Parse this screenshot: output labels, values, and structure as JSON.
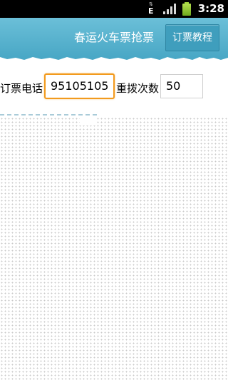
{
  "status_bar": {
    "network_type": "E",
    "network_arrows": "⇅",
    "time": "3:28"
  },
  "header": {
    "title": "春运火车票抢票",
    "tutorial_button": "订票教程",
    "background_color": "#5bb4d0"
  },
  "form": {
    "phone_label": "订票电话",
    "phone_value": "95105105",
    "retry_label": "重拨次数",
    "retry_value": "50"
  },
  "colors": {
    "accent": "#f29a1d",
    "header": "#5bb4d0",
    "divider": "#a9cbd8"
  }
}
